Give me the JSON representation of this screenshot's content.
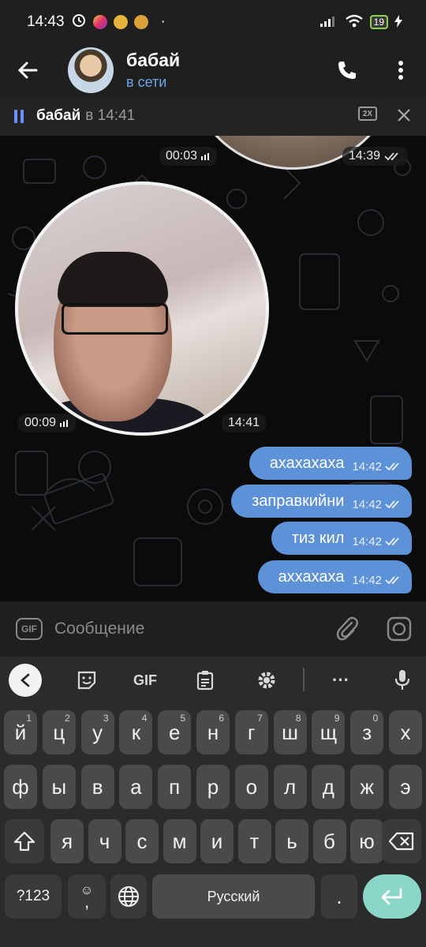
{
  "status_bar": {
    "time": "14:43",
    "dot": "·",
    "battery": "19"
  },
  "header": {
    "contact_name": "бабай",
    "status": "в сети"
  },
  "player": {
    "name": "бабай",
    "time": "в 14:41",
    "speed": "2X"
  },
  "messages": {
    "prev_video_duration": "00:03",
    "prev_video_time": "14:39",
    "video_duration": "00:09",
    "video_time": "14:41",
    "texts": [
      {
        "text": "ахахахаха",
        "time": "14:42"
      },
      {
        "text": "заправкийни",
        "time": "14:42"
      },
      {
        "text": "тиз кил",
        "time": "14:42"
      },
      {
        "text": "аххахаха",
        "time": "14:42"
      }
    ]
  },
  "input": {
    "placeholder": "Сообщение",
    "gif_label": "GIF"
  },
  "keyboard": {
    "toolbar_gif": "GIF",
    "toolbar_more": "···",
    "row1": [
      {
        "k": "й",
        "s": "1"
      },
      {
        "k": "ц",
        "s": "2"
      },
      {
        "k": "у",
        "s": "3"
      },
      {
        "k": "к",
        "s": "4"
      },
      {
        "k": "е",
        "s": "5"
      },
      {
        "k": "н",
        "s": "6"
      },
      {
        "k": "г",
        "s": "7"
      },
      {
        "k": "ш",
        "s": "8"
      },
      {
        "k": "щ",
        "s": "9"
      },
      {
        "k": "з",
        "s": "0"
      },
      {
        "k": "х",
        "s": ""
      }
    ],
    "row2": [
      "ф",
      "ы",
      "в",
      "а",
      "п",
      "р",
      "о",
      "л",
      "д",
      "ж",
      "э"
    ],
    "row3": [
      "я",
      "ч",
      "с",
      "м",
      "и",
      "т",
      "ь",
      "б",
      "ю"
    ],
    "symbols_key": "?123",
    "emoji_key": "☺",
    "comma": ",",
    "space_label": "Русский",
    "period": "."
  },
  "colors": {
    "outgoing_bubble": "#5d92d8",
    "online": "#6aa8e8",
    "accent_pause": "#6b8ff7",
    "enter_key": "#8ad6c9"
  }
}
